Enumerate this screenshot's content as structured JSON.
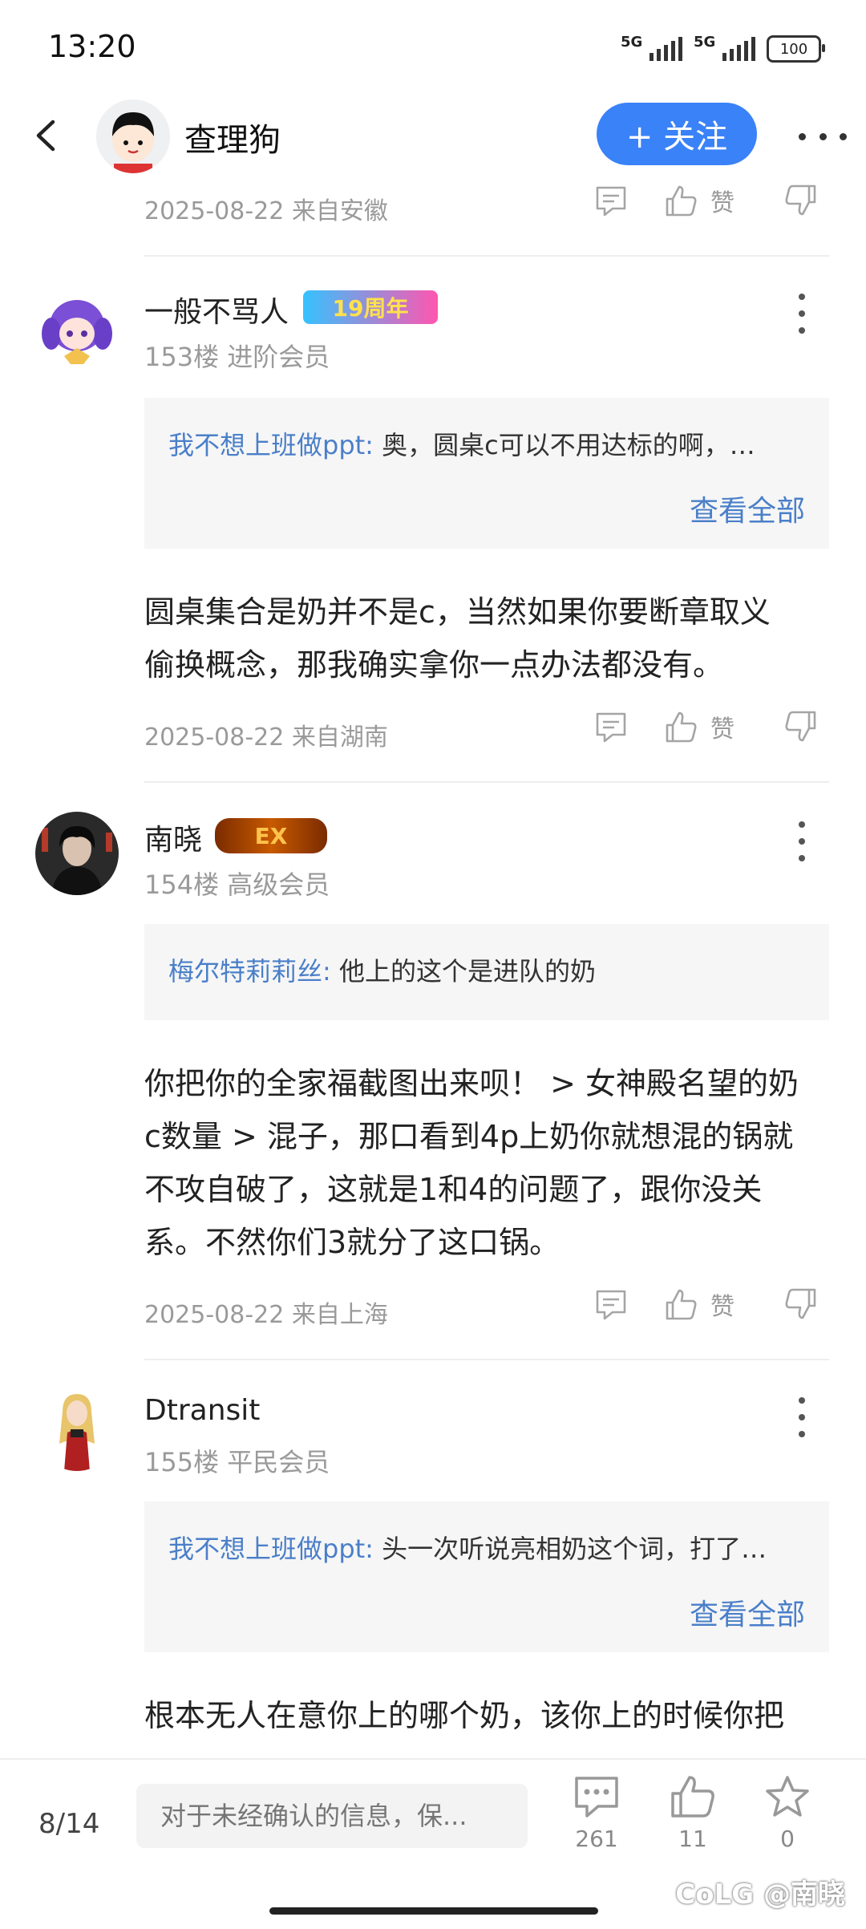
{
  "status": {
    "time": "13:20",
    "net1": "5G",
    "net2": "5G",
    "battery": "100"
  },
  "header": {
    "author": "查理狗",
    "follow_label": "+ 关注"
  },
  "top_meta": {
    "date": "2025-08-22 来自安徽",
    "like_label": "赞"
  },
  "comments": [
    {
      "name": "一般不骂人",
      "badge": "19周年",
      "floor": "153楼 进阶会员",
      "quote_user": "我不想上班做ppt:",
      "quote_text": " 奥，圆桌c可以不用达标的啊，…",
      "quote_all": "查看全部",
      "lines": [
        "圆桌集合是奶并不是c，当然如果你要断章取义",
        "偷换概念，那我确实拿你一点办法都没有。"
      ],
      "date": "2025-08-22 来自湖南",
      "like_label": "赞"
    },
    {
      "name": "南晓",
      "badge": "EX",
      "floor": "154楼 高级会员",
      "quote_user": "梅尔特莉莉丝:",
      "quote_text": " 他上的这个是进队的奶",
      "lines": [
        "你把你的全家福截图出来呗！ > 女神殿名望的奶",
        "c数量 > 混子，那口看到4p上奶你就想混的锅就",
        "不攻自破了，这就是1和4的问题了，跟你没关",
        "系。不然你们3就分了这口锅。"
      ],
      "date": "2025-08-22 来自上海",
      "like_label": "赞"
    },
    {
      "name": "Dtransit",
      "floor": "155楼 平民会员",
      "quote_user": "我不想上班做ppt:",
      "quote_text": " 头一次听说亮相奶这个词，打了…",
      "quote_all": "查看全部",
      "lines": [
        "根本无人在意你上的哪个奶，该你上的时候你把"
      ]
    }
  ],
  "bottom": {
    "page": "8/14",
    "input_placeholder": "对于未经确认的信息，保...",
    "comments_count": "261",
    "likes_count": "11",
    "fav_count": "0",
    "watermark": "CoLG @南晓"
  },
  "colors": {
    "accent": "#3a82f7",
    "link": "#4a7fc9",
    "meta": "#9a9a9a"
  }
}
